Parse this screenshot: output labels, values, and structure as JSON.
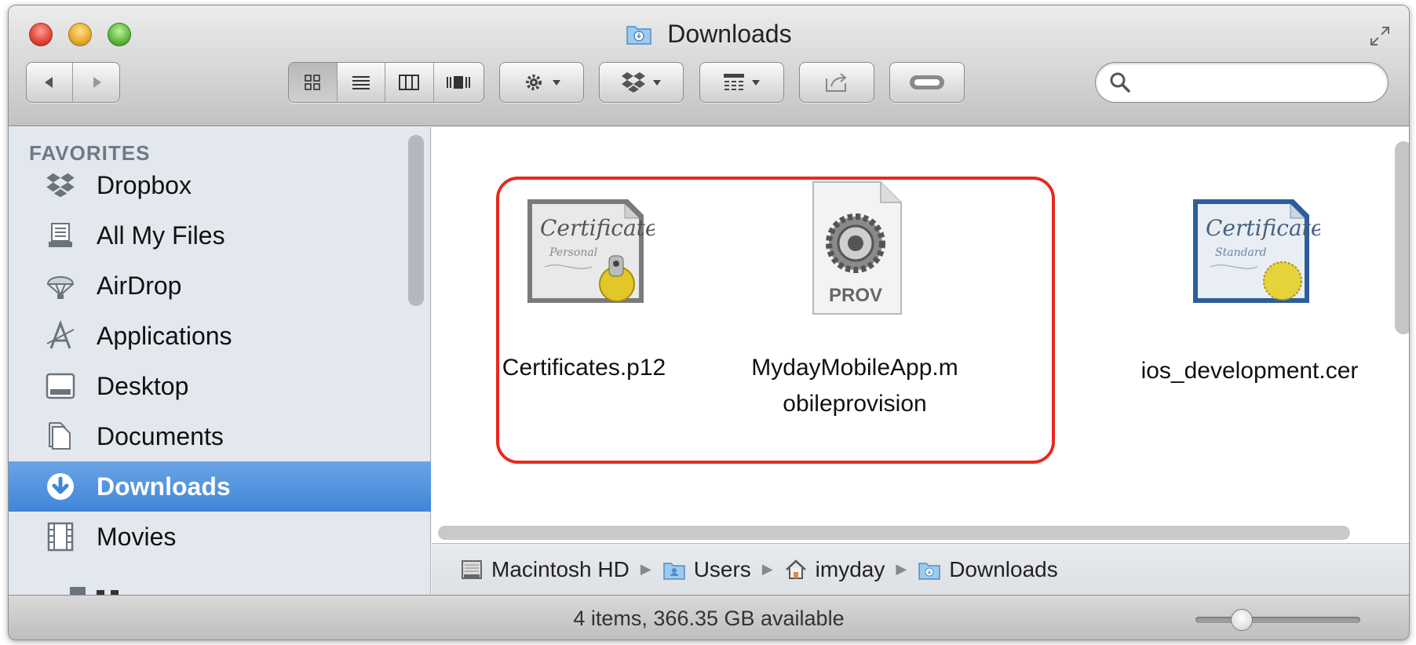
{
  "window": {
    "title": "Downloads"
  },
  "toolbar": {
    "search_placeholder": "",
    "view_modes": [
      "icon-view",
      "list-view",
      "column-view",
      "cover-flow-view"
    ],
    "buttons": [
      "action-gear",
      "dropbox-menu",
      "arrange-menu",
      "share",
      "toggle-tags"
    ]
  },
  "sidebar": {
    "heading": "FAVORITES",
    "items": [
      {
        "label": "Dropbox",
        "icon": "dropbox-icon"
      },
      {
        "label": "All My Files",
        "icon": "all-my-files-icon"
      },
      {
        "label": "AirDrop",
        "icon": "airdrop-icon"
      },
      {
        "label": "Applications",
        "icon": "applications-icon"
      },
      {
        "label": "Desktop",
        "icon": "desktop-icon"
      },
      {
        "label": "Documents",
        "icon": "documents-icon"
      },
      {
        "label": "Downloads",
        "icon": "downloads-icon",
        "selected": true
      },
      {
        "label": "Movies",
        "icon": "movies-icon"
      }
    ]
  },
  "files": [
    {
      "name": "Certificates.p12",
      "icon": "certificate-personal-icon"
    },
    {
      "name_line1": "MydayMobileApp.m",
      "name_line2": "obileprovision",
      "icon": "provisioning-profile-icon",
      "icon_label": "PROV"
    },
    {
      "name": "ios_development.cer",
      "icon": "certificate-standard-icon"
    }
  ],
  "pathbar": {
    "crumbs": [
      "Macintosh HD",
      "Users",
      "imyday",
      "Downloads"
    ]
  },
  "statusbar": {
    "text": "4 items, 366.35 GB available",
    "icon_size_fraction": 0.28
  },
  "colors": {
    "highlight": "#e8291b",
    "selection": "#3f86d8",
    "sidebar_bg": "#e3e8ee"
  }
}
